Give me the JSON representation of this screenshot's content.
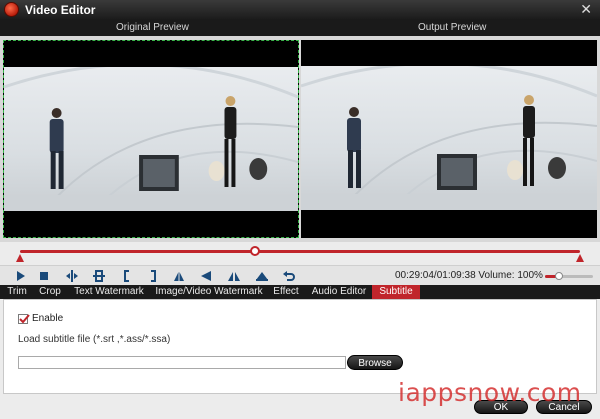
{
  "window": {
    "title": "Video Editor",
    "close_glyph": "✕"
  },
  "preview": {
    "original_label": "Original Preview",
    "output_label": "Output Preview"
  },
  "playback": {
    "timecode": "00:29:04/01:09:38",
    "volume_label": "Volume:",
    "volume_value": "100%",
    "volume_level": 0.3,
    "progress": 0.42,
    "controls": [
      "play-icon",
      "stop-icon",
      "prev-frame-icon",
      "next-frame-icon",
      "mark-in-icon",
      "mark-out-icon",
      "flip-vertical-icon",
      "flip-horizontal-icon",
      "rotate-left-icon",
      "rotate-right-icon",
      "undo-icon"
    ]
  },
  "tabs": [
    {
      "label": "Trim"
    },
    {
      "label": "Crop"
    },
    {
      "label": "Text Watermark"
    },
    {
      "label": "Image/Video Watermark"
    },
    {
      "label": "Effect"
    },
    {
      "label": "Audio Editor"
    },
    {
      "label": "Subtitle"
    }
  ],
  "active_tab": "Subtitle",
  "subtitle": {
    "enable_label": "Enable",
    "enabled": true,
    "load_label": "Load subtitle file (*.srt ,*.ass/*.ssa)",
    "file_value": "",
    "browse_label": "Browse"
  },
  "footer": {
    "ok_label": "OK",
    "cancel_label": "Cancel"
  },
  "watermark": "iappsnow.com",
  "colors": {
    "accent": "#c0252b",
    "titlebar": "#1c1c1c",
    "frame_border": "#39b54a"
  }
}
